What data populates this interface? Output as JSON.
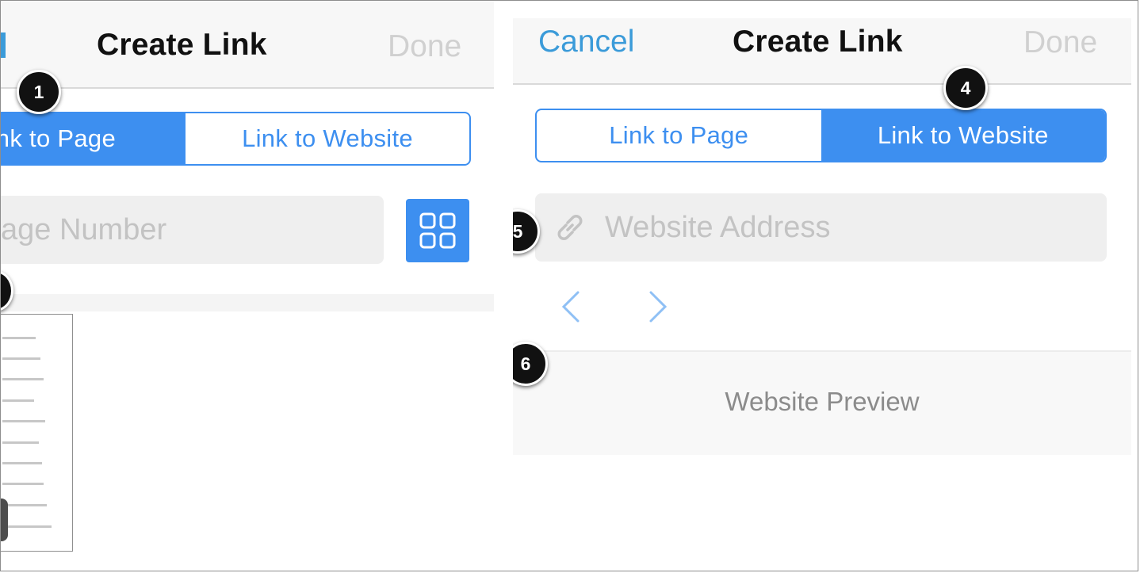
{
  "left_panel": {
    "title": "Create Link",
    "done_label": "Done",
    "segment": {
      "page_label": "nk to Page",
      "website_label": "Link to Website"
    },
    "page_field": {
      "placeholder": "age Number"
    },
    "grid_button_icon": "grid-icon",
    "callout_number": "1"
  },
  "right_panel": {
    "cancel_label": "Cancel",
    "title": "Create Link",
    "done_label": "Done",
    "segment": {
      "page_label": "Link to Page",
      "website_label": "Link to Website"
    },
    "address_field": {
      "placeholder": "Website Address",
      "icon": "link-icon"
    },
    "back_icon": "chevron-left-icon",
    "forward_icon": "chevron-right-icon",
    "preview_label": "Website Preview",
    "callouts": [
      "4",
      "5",
      "6"
    ]
  },
  "colors": {
    "accent": "#3d8ff0",
    "cancel_text": "#3b9bd9",
    "disabled_text": "#d0d0d0",
    "callout_bg": "#111111"
  }
}
